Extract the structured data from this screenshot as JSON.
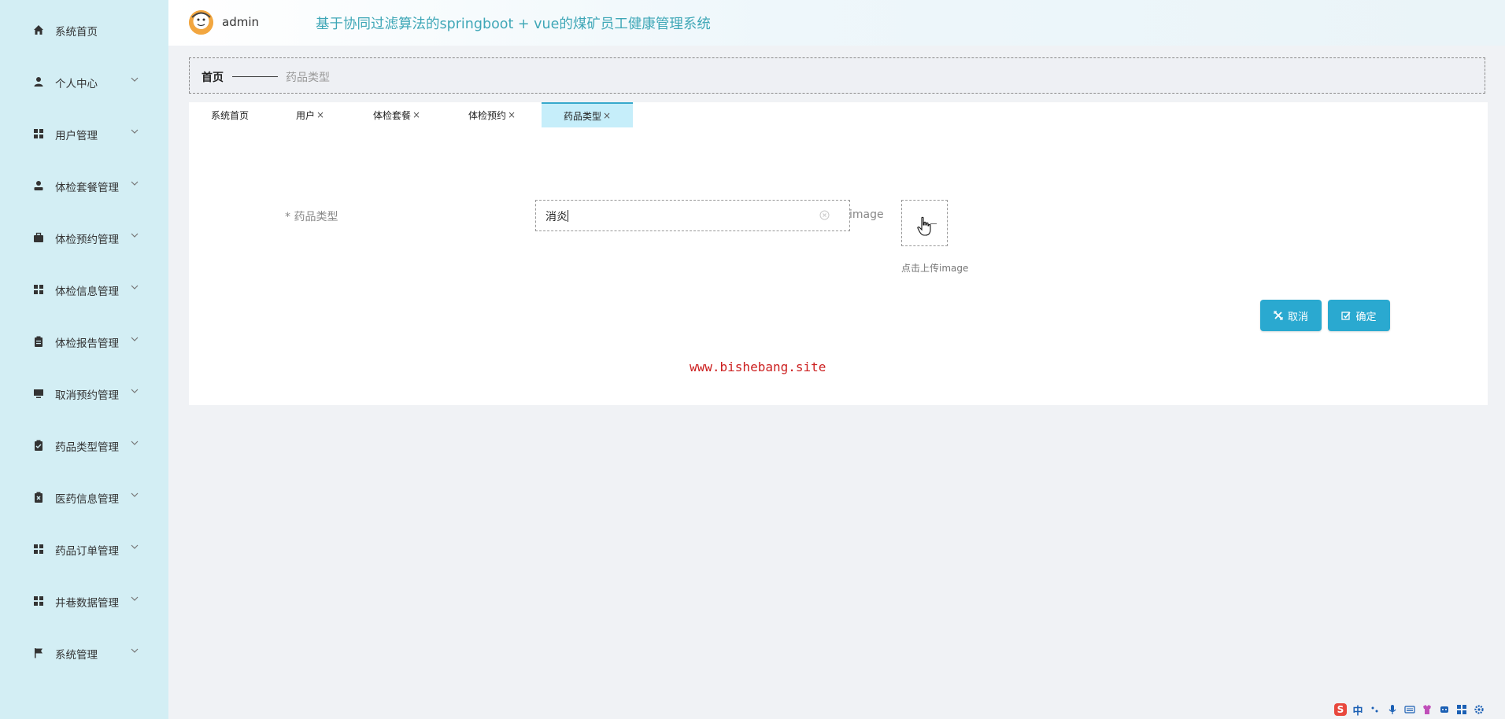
{
  "header": {
    "username": "admin",
    "app_title": "基于协同过滤算法的springboot + vue的煤矿员工健康管理系统"
  },
  "sidebar": {
    "items": [
      {
        "label": "系统首页",
        "icon": "home-icon",
        "expandable": false
      },
      {
        "label": "个人中心",
        "icon": "person-icon",
        "expandable": true
      },
      {
        "label": "用户管理",
        "icon": "grid-icon",
        "expandable": true
      },
      {
        "label": "体检套餐管理",
        "icon": "user-icon",
        "expandable": true
      },
      {
        "label": "体检预约管理",
        "icon": "briefcase-icon",
        "expandable": true
      },
      {
        "label": "体检信息管理",
        "icon": "grid-icon",
        "expandable": true
      },
      {
        "label": "体检报告管理",
        "icon": "clipboard-icon",
        "expandable": true
      },
      {
        "label": "取消预约管理",
        "icon": "monitor-icon",
        "expandable": true
      },
      {
        "label": "药品类型管理",
        "icon": "clipboard-check-icon",
        "expandable": true
      },
      {
        "label": "医药信息管理",
        "icon": "clipboard-x-icon",
        "expandable": true
      },
      {
        "label": "药品订单管理",
        "icon": "grid-icon",
        "expandable": true
      },
      {
        "label": "井巷数据管理",
        "icon": "grid-icon",
        "expandable": true
      },
      {
        "label": "系统管理",
        "icon": "flag-icon",
        "expandable": true
      }
    ]
  },
  "breadcrumb": {
    "home": "首页",
    "current": "药品类型"
  },
  "tabs": [
    {
      "label": "系统首页",
      "closable": false,
      "active": false
    },
    {
      "label": "用户",
      "closable": true,
      "active": false
    },
    {
      "label": "体检套餐",
      "closable": true,
      "active": false
    },
    {
      "label": "体检预约",
      "closable": true,
      "active": false
    },
    {
      "label": "药品类型",
      "closable": true,
      "active": true
    }
  ],
  "tab_close_glyph": "×",
  "form": {
    "type_label": "* 药品类型",
    "type_value": "消炎",
    "image_label": "image",
    "upload_hint": "点击上传image",
    "cancel_label": "取消",
    "confirm_label": "确定"
  },
  "watermark": "www.bishebang.site",
  "colors": {
    "sidebar_bg": "#d3eef4",
    "accent": "#2aa9d0",
    "title": "#3fa7b7",
    "active_tab": "#c6eefa",
    "watermark": "#cc1f1f"
  },
  "tray": {
    "ime_label": "中"
  }
}
